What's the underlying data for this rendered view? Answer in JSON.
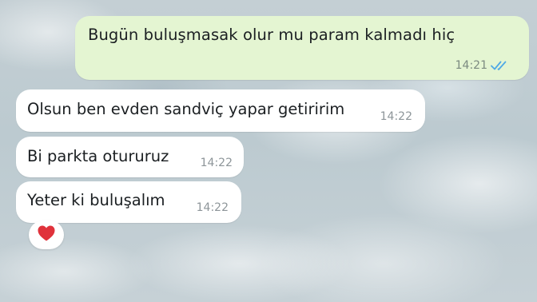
{
  "messages": {
    "outgoing": [
      {
        "text": "Bugün buluşmasak olur mu param kalmadı hiç",
        "time": "14:21",
        "status_icon": "double-check-icon"
      }
    ],
    "incoming": [
      {
        "text": "Olsun ben evden sandviç yapar getiririm",
        "time": "14:22"
      },
      {
        "text": "Bi parkta otururuz",
        "time": "14:22"
      },
      {
        "text": "Yeter ki buluşalım",
        "time": "14:22"
      }
    ]
  },
  "reaction": {
    "icon": "heart-icon",
    "color": "#e0323b"
  },
  "colors": {
    "outgoing_bubble": "#e4f5d2",
    "incoming_bubble": "#ffffff",
    "read_ticks": "#4fa9e6"
  }
}
